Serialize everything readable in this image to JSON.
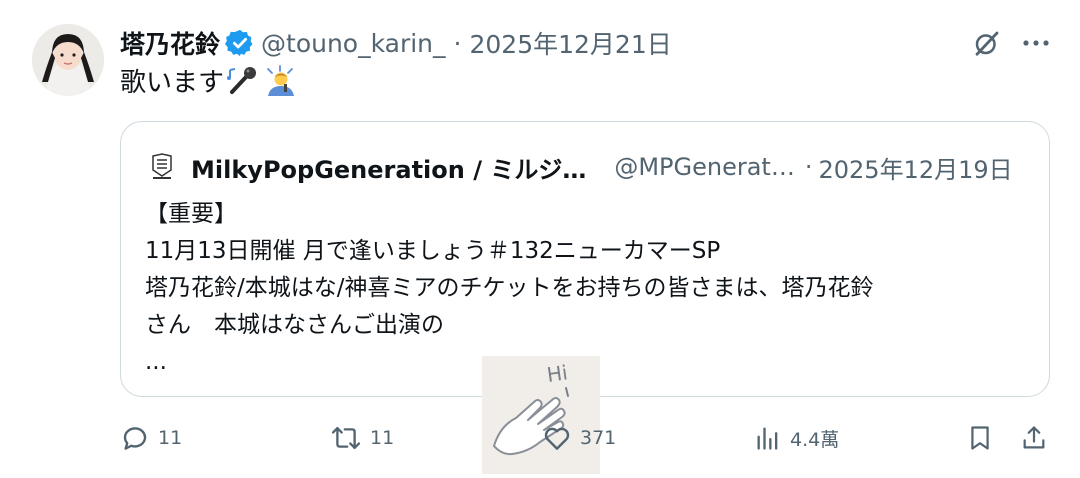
{
  "post": {
    "author_name": "塔乃花鈴",
    "handle": "@touno_karin_",
    "separator": "·",
    "date": "2025年12月21日",
    "text": "歌います",
    "emojis": [
      "microphone-emoji",
      "singer-emoji"
    ]
  },
  "quote": {
    "author_name": "MilkyPopGeneration / ミルジ…",
    "handle": "@MPGenerat…",
    "separator": "·",
    "date": "2025年12月19日",
    "lines": [
      "【重要】",
      "11月13日開催 月で逢いましょう＃132ニューカマーSP",
      "塔乃花鈴/本城はな/神喜ミアのチケットをお持ちの皆さまは、塔乃花鈴",
      "さん　本城はなさんご出演の",
      "..."
    ]
  },
  "actions": {
    "replies": "11",
    "reposts": "11",
    "likes": "371",
    "views": "4.4萬"
  },
  "sticker": {
    "text": "Hi"
  },
  "colors": {
    "text": "#0f1419",
    "secondary": "#536471",
    "verified": "#1d9bf0",
    "border": "#cfd9de"
  }
}
